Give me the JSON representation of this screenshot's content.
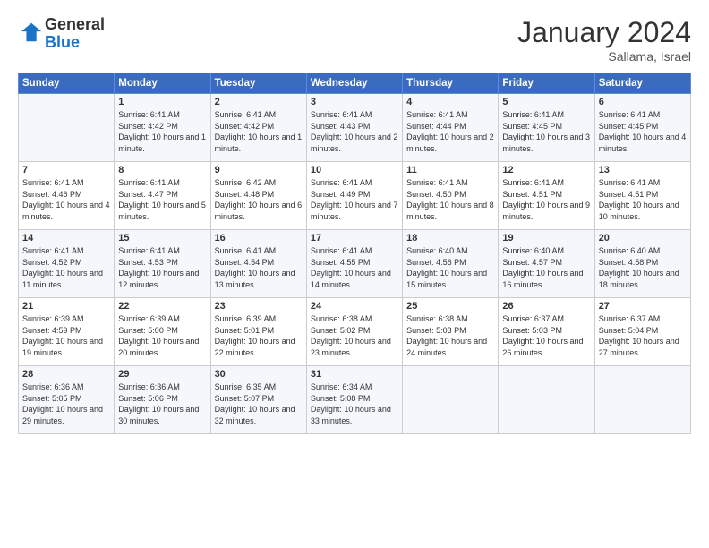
{
  "logo": {
    "general": "General",
    "blue": "Blue"
  },
  "header": {
    "title": "January 2024",
    "location": "Sallama, Israel"
  },
  "columns": [
    "Sunday",
    "Monday",
    "Tuesday",
    "Wednesday",
    "Thursday",
    "Friday",
    "Saturday"
  ],
  "weeks": [
    [
      {
        "day": "",
        "sunrise": "",
        "sunset": "",
        "daylight": ""
      },
      {
        "day": "1",
        "sunrise": "Sunrise: 6:41 AM",
        "sunset": "Sunset: 4:42 PM",
        "daylight": "Daylight: 10 hours and 1 minute."
      },
      {
        "day": "2",
        "sunrise": "Sunrise: 6:41 AM",
        "sunset": "Sunset: 4:42 PM",
        "daylight": "Daylight: 10 hours and 1 minute."
      },
      {
        "day": "3",
        "sunrise": "Sunrise: 6:41 AM",
        "sunset": "Sunset: 4:43 PM",
        "daylight": "Daylight: 10 hours and 2 minutes."
      },
      {
        "day": "4",
        "sunrise": "Sunrise: 6:41 AM",
        "sunset": "Sunset: 4:44 PM",
        "daylight": "Daylight: 10 hours and 2 minutes."
      },
      {
        "day": "5",
        "sunrise": "Sunrise: 6:41 AM",
        "sunset": "Sunset: 4:45 PM",
        "daylight": "Daylight: 10 hours and 3 minutes."
      },
      {
        "day": "6",
        "sunrise": "Sunrise: 6:41 AM",
        "sunset": "Sunset: 4:45 PM",
        "daylight": "Daylight: 10 hours and 4 minutes."
      }
    ],
    [
      {
        "day": "7",
        "sunrise": "Sunrise: 6:41 AM",
        "sunset": "Sunset: 4:46 PM",
        "daylight": "Daylight: 10 hours and 4 minutes."
      },
      {
        "day": "8",
        "sunrise": "Sunrise: 6:41 AM",
        "sunset": "Sunset: 4:47 PM",
        "daylight": "Daylight: 10 hours and 5 minutes."
      },
      {
        "day": "9",
        "sunrise": "Sunrise: 6:42 AM",
        "sunset": "Sunset: 4:48 PM",
        "daylight": "Daylight: 10 hours and 6 minutes."
      },
      {
        "day": "10",
        "sunrise": "Sunrise: 6:41 AM",
        "sunset": "Sunset: 4:49 PM",
        "daylight": "Daylight: 10 hours and 7 minutes."
      },
      {
        "day": "11",
        "sunrise": "Sunrise: 6:41 AM",
        "sunset": "Sunset: 4:50 PM",
        "daylight": "Daylight: 10 hours and 8 minutes."
      },
      {
        "day": "12",
        "sunrise": "Sunrise: 6:41 AM",
        "sunset": "Sunset: 4:51 PM",
        "daylight": "Daylight: 10 hours and 9 minutes."
      },
      {
        "day": "13",
        "sunrise": "Sunrise: 6:41 AM",
        "sunset": "Sunset: 4:51 PM",
        "daylight": "Daylight: 10 hours and 10 minutes."
      }
    ],
    [
      {
        "day": "14",
        "sunrise": "Sunrise: 6:41 AM",
        "sunset": "Sunset: 4:52 PM",
        "daylight": "Daylight: 10 hours and 11 minutes."
      },
      {
        "day": "15",
        "sunrise": "Sunrise: 6:41 AM",
        "sunset": "Sunset: 4:53 PM",
        "daylight": "Daylight: 10 hours and 12 minutes."
      },
      {
        "day": "16",
        "sunrise": "Sunrise: 6:41 AM",
        "sunset": "Sunset: 4:54 PM",
        "daylight": "Daylight: 10 hours and 13 minutes."
      },
      {
        "day": "17",
        "sunrise": "Sunrise: 6:41 AM",
        "sunset": "Sunset: 4:55 PM",
        "daylight": "Daylight: 10 hours and 14 minutes."
      },
      {
        "day": "18",
        "sunrise": "Sunrise: 6:40 AM",
        "sunset": "Sunset: 4:56 PM",
        "daylight": "Daylight: 10 hours and 15 minutes."
      },
      {
        "day": "19",
        "sunrise": "Sunrise: 6:40 AM",
        "sunset": "Sunset: 4:57 PM",
        "daylight": "Daylight: 10 hours and 16 minutes."
      },
      {
        "day": "20",
        "sunrise": "Sunrise: 6:40 AM",
        "sunset": "Sunset: 4:58 PM",
        "daylight": "Daylight: 10 hours and 18 minutes."
      }
    ],
    [
      {
        "day": "21",
        "sunrise": "Sunrise: 6:39 AM",
        "sunset": "Sunset: 4:59 PM",
        "daylight": "Daylight: 10 hours and 19 minutes."
      },
      {
        "day": "22",
        "sunrise": "Sunrise: 6:39 AM",
        "sunset": "Sunset: 5:00 PM",
        "daylight": "Daylight: 10 hours and 20 minutes."
      },
      {
        "day": "23",
        "sunrise": "Sunrise: 6:39 AM",
        "sunset": "Sunset: 5:01 PM",
        "daylight": "Daylight: 10 hours and 22 minutes."
      },
      {
        "day": "24",
        "sunrise": "Sunrise: 6:38 AM",
        "sunset": "Sunset: 5:02 PM",
        "daylight": "Daylight: 10 hours and 23 minutes."
      },
      {
        "day": "25",
        "sunrise": "Sunrise: 6:38 AM",
        "sunset": "Sunset: 5:03 PM",
        "daylight": "Daylight: 10 hours and 24 minutes."
      },
      {
        "day": "26",
        "sunrise": "Sunrise: 6:37 AM",
        "sunset": "Sunset: 5:03 PM",
        "daylight": "Daylight: 10 hours and 26 minutes."
      },
      {
        "day": "27",
        "sunrise": "Sunrise: 6:37 AM",
        "sunset": "Sunset: 5:04 PM",
        "daylight": "Daylight: 10 hours and 27 minutes."
      }
    ],
    [
      {
        "day": "28",
        "sunrise": "Sunrise: 6:36 AM",
        "sunset": "Sunset: 5:05 PM",
        "daylight": "Daylight: 10 hours and 29 minutes."
      },
      {
        "day": "29",
        "sunrise": "Sunrise: 6:36 AM",
        "sunset": "Sunset: 5:06 PM",
        "daylight": "Daylight: 10 hours and 30 minutes."
      },
      {
        "day": "30",
        "sunrise": "Sunrise: 6:35 AM",
        "sunset": "Sunset: 5:07 PM",
        "daylight": "Daylight: 10 hours and 32 minutes."
      },
      {
        "day": "31",
        "sunrise": "Sunrise: 6:34 AM",
        "sunset": "Sunset: 5:08 PM",
        "daylight": "Daylight: 10 hours and 33 minutes."
      },
      {
        "day": "",
        "sunrise": "",
        "sunset": "",
        "daylight": ""
      },
      {
        "day": "",
        "sunrise": "",
        "sunset": "",
        "daylight": ""
      },
      {
        "day": "",
        "sunrise": "",
        "sunset": "",
        "daylight": ""
      }
    ]
  ]
}
